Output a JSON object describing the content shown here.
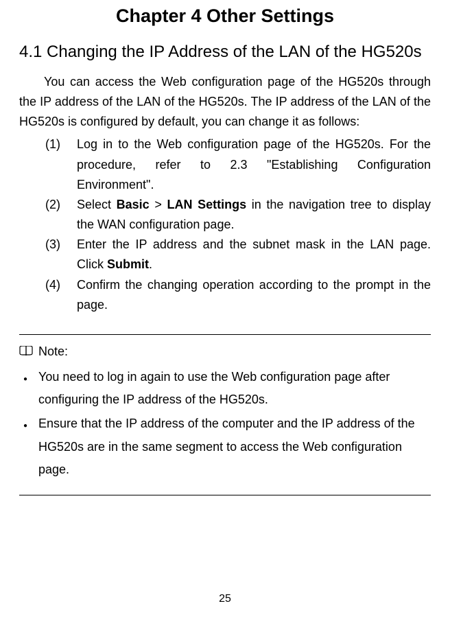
{
  "chapter": {
    "title": "Chapter 4  Other Settings"
  },
  "section": {
    "title": "4.1  Changing the IP Address of the LAN of the HG520s"
  },
  "intro": "You can access the Web configuration page of the HG520s through the IP address of the LAN of the HG520s. The IP address of the LAN of the HG520s is configured by default, you can change it as follows:",
  "steps": [
    {
      "num": "(1)",
      "seg1": "Log in to the Web configuration page of the HG520s. For the procedure, refer to 2.3  \"Establishing Configuration Environment\"."
    },
    {
      "num": "(2)",
      "seg1": "Select ",
      "bold1": "Basic",
      "seg2": " > ",
      "bold2": "LAN Settings",
      "seg3": " in the navigation tree to display the WAN configuration page."
    },
    {
      "num": "(3)",
      "seg1": "Enter the IP address and the subnet mask in the LAN page. Click ",
      "bold1": "Submit",
      "seg2": "."
    },
    {
      "num": "(4)",
      "seg1": "Confirm the changing operation according to the prompt in the page."
    }
  ],
  "note": {
    "label": "Note:",
    "items": [
      "You need to log in again to use the Web configuration page after configuring the IP address of the HG520s.",
      "Ensure that the IP address of the computer and the IP address of the HG520s are in the same segment to access the Web configuration page."
    ]
  },
  "pageNumber": "25"
}
